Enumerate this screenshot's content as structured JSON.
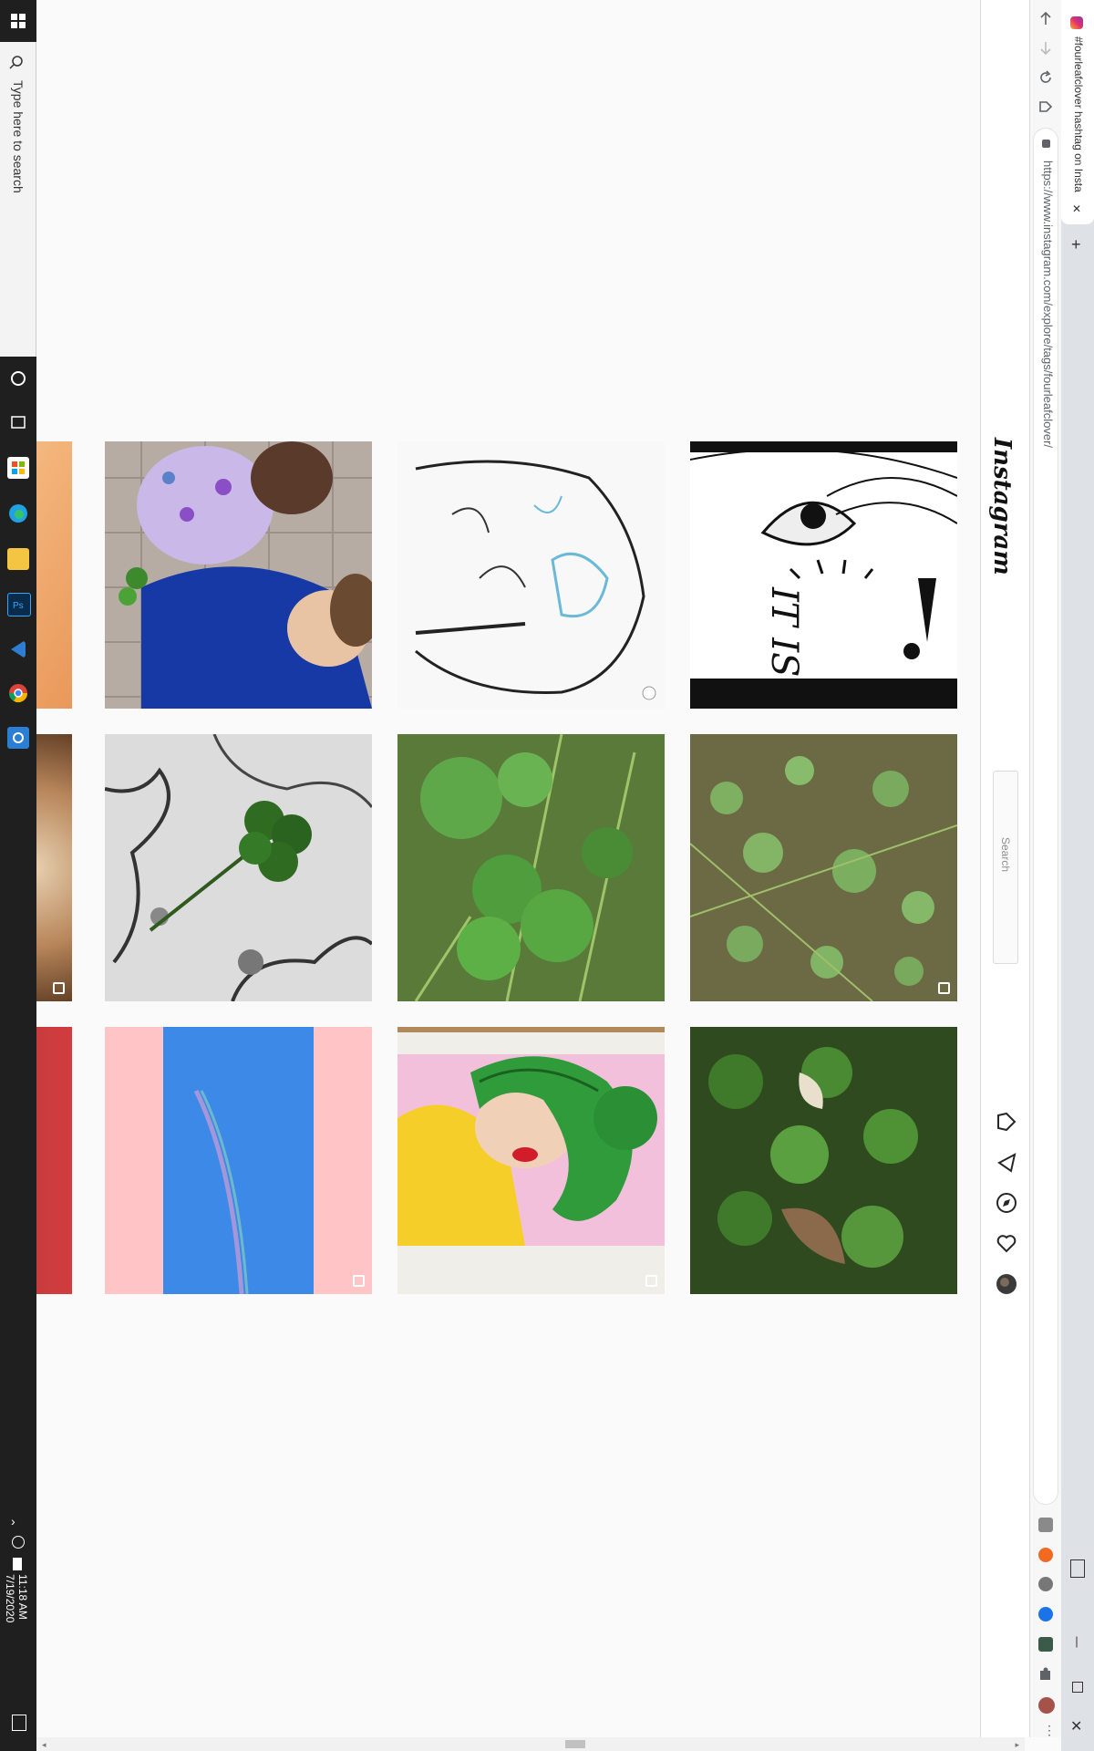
{
  "taskbar": {
    "search_placeholder": "Type here to search",
    "time": "11:18 AM",
    "date": "7/19/2020"
  },
  "browser": {
    "tab_title": "#fourleafclover hashtag on Insta",
    "url": "https://www.instagram.com/explore/tags/fourleafclover/",
    "new_tab_symbol": "+",
    "close_symbol": "✕"
  },
  "instagram": {
    "logo": "Instagram",
    "search_placeholder": "Search"
  },
  "grid": {
    "rows": [
      {
        "tiles": [
          "partial-photo",
          "children-with-clover",
          "clover-line-sketch",
          "it-is-that-comic"
        ]
      },
      {
        "tiles": [
          "partial-dog-photo",
          "clover-on-cracked-ground",
          "clover-in-grass",
          "clover-patch"
        ]
      },
      {
        "tiles": [
          "partial-red-photo",
          "rainbow-sky",
          "green-hair-portrait",
          "clover-leaves"
        ]
      }
    ],
    "comic_text": "IT IS THAT"
  },
  "colors": {
    "taskbar": "#1f1f1f",
    "page_bg": "#fafafa"
  }
}
